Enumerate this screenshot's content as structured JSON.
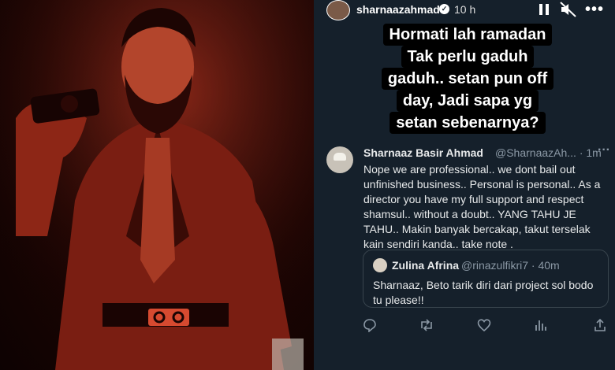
{
  "story": {
    "username": "sharnaazahmad",
    "time": "10 h"
  },
  "caption": {
    "lines": [
      "Hormati lah ramadan",
      "Tak perlu gaduh",
      "gaduh.. setan pun off",
      "day, Jadi sapa yg",
      "setan sebenarnya?"
    ]
  },
  "tweet": {
    "name": "Sharnaaz Basir Ahmad",
    "handle": "@SharnaazAh... · 1m",
    "lines": [
      "Nope we are professional.. we dont bail out",
      "unfinished business.. Personal is personal.. As a",
      "director you have my full support and respect",
      "shamsul.. without a doubt.. YANG TAHU JE",
      "TAHU.. Makin banyak bercakap, takut terselak",
      "kain sendiri kanda.. take note ."
    ],
    "quote": {
      "name": "Zulina Afrina",
      "handle": "@rinazulfikri7 · 40m",
      "lines": [
        "Sharnaaz, Beto tarik diri dari project sol bodo",
        "tu please!!"
      ]
    }
  },
  "colors": {
    "panel_bg": "#15202b",
    "text_primary": "#e7e9ea",
    "text_secondary": "#8b98a5",
    "photo_tint": "#c0301c"
  }
}
